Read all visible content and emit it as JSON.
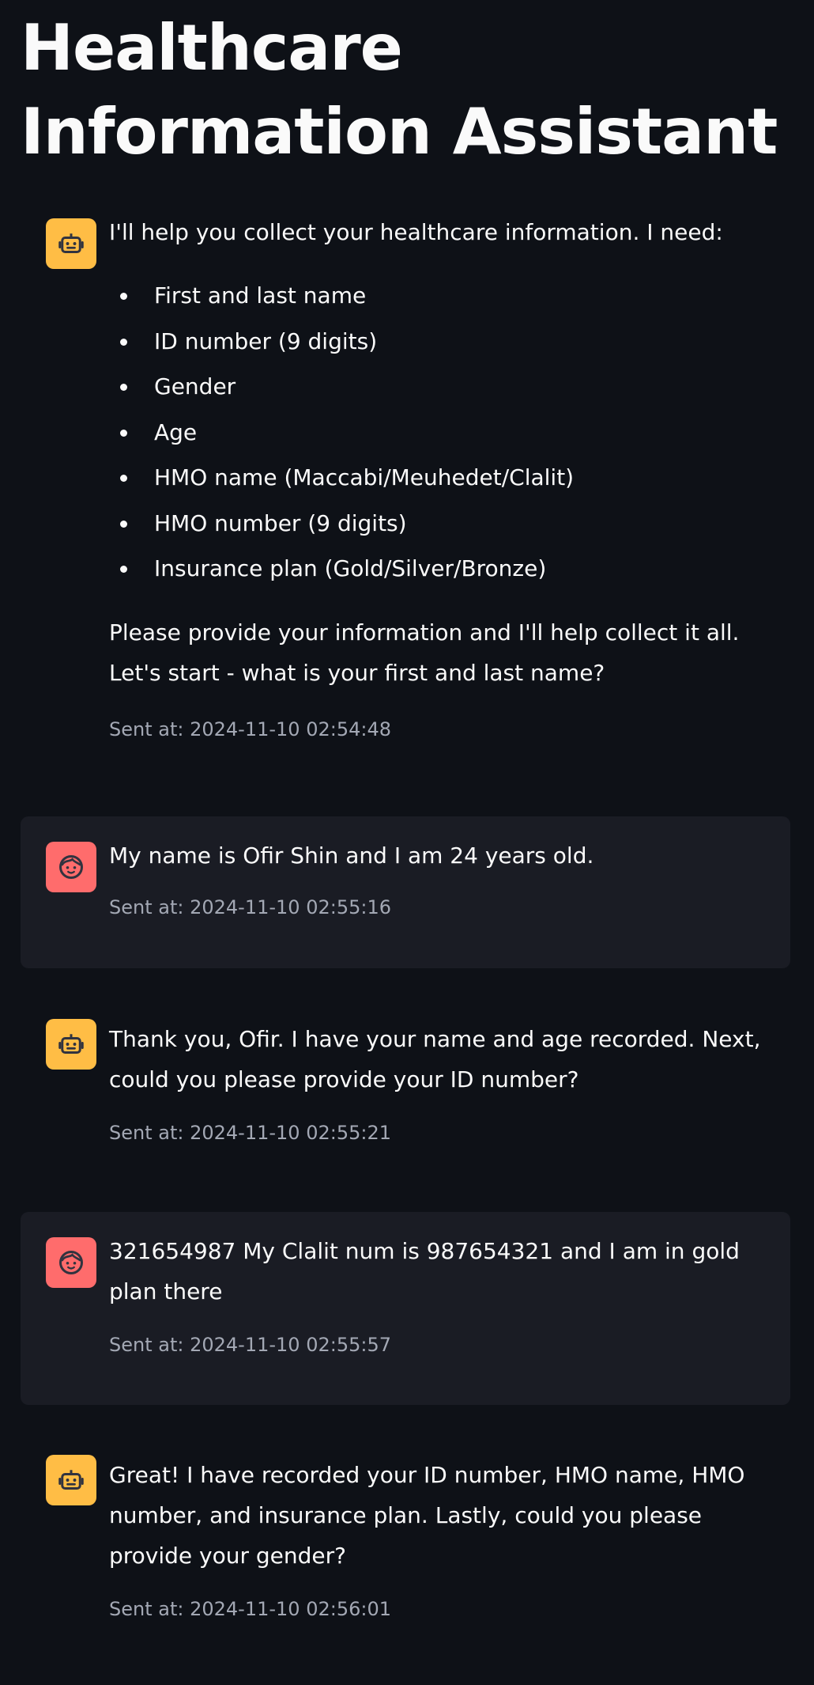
{
  "app": {
    "title": "Healthcare Information Assistant"
  },
  "messages": [
    {
      "role": "assistant",
      "intro": "I'll help you collect your healthcare information. I need:",
      "list": [
        "First and last name",
        "ID number (9 digits)",
        "Gender",
        "Age",
        "HMO name (Maccabi/Meuhedet/Clalit)",
        "HMO number (9 digits)",
        "Insurance plan (Gold/Silver/Bronze)"
      ],
      "text": "Please provide your information and I'll help collect it all. Let's start - what is your first and last name?",
      "timestamp": "Sent at: 2024-11-10 02:54:48"
    },
    {
      "role": "user",
      "text": "My name is Ofir Shin and I am 24 years old.",
      "timestamp": "Sent at: 2024-11-10 02:55:16"
    },
    {
      "role": "assistant",
      "text": "Thank you, Ofir. I have your name and age recorded. Next, could you please provide your ID number?",
      "timestamp": "Sent at: 2024-11-10 02:55:21"
    },
    {
      "role": "user",
      "text": "321654987 My Clalit num is 987654321 and I am in gold plan there",
      "timestamp": "Sent at: 2024-11-10 02:55:57"
    },
    {
      "role": "assistant",
      "text": "Great! I have recorded your ID number, HMO name, HMO number, and insurance plan. Lastly, could you please provide your gender?",
      "timestamp": "Sent at: 2024-11-10 02:56:01"
    }
  ],
  "colors": {
    "background": "#0e1117",
    "user_message_bg": "#1a1c24",
    "assistant_avatar": "#ffbd45",
    "user_avatar": "#ff6c6c",
    "text": "#fafafa",
    "timestamp": "#a3a8b4"
  },
  "icons": {
    "assistant_avatar": "robot-icon",
    "user_avatar": "face-icon"
  }
}
